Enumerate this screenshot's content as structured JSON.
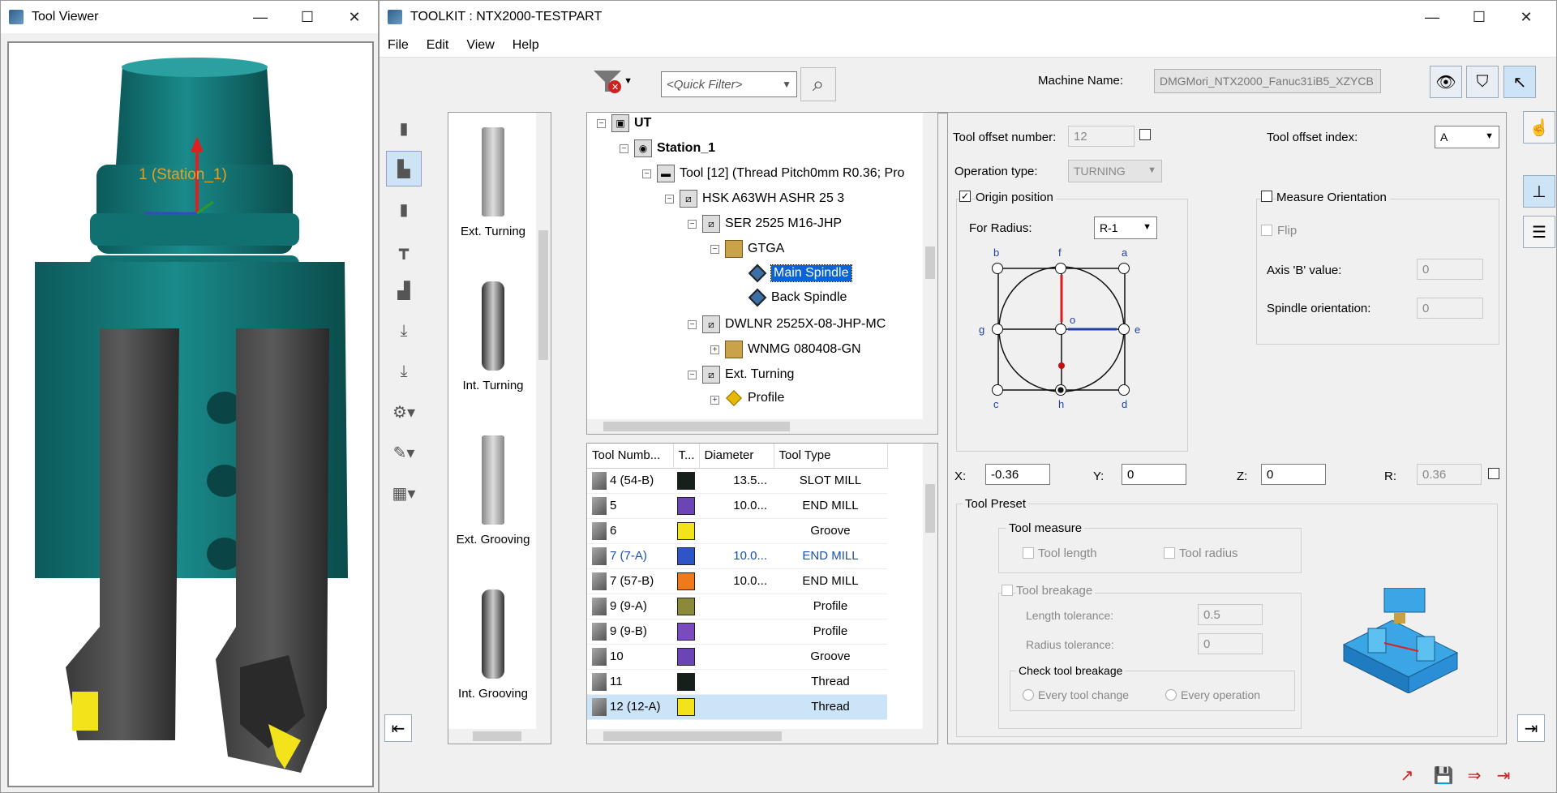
{
  "viewer": {
    "title": "Tool Viewer",
    "label3d": "1 (Station_1)"
  },
  "window": {
    "minimize": "—",
    "maximize": "☐",
    "close": "✕"
  },
  "main": {
    "title": "TOOLKIT : NTX2000-TESTPART"
  },
  "menu": [
    "File",
    "Edit",
    "View",
    "Help"
  ],
  "toolbar": {
    "quick_filter": "<Quick Filter>",
    "machine_label": "Machine Name:",
    "machine_value": "DMGMori_NTX2000_Fanuc31iB5_XZYCB"
  },
  "catalog": [
    "Ext. Turning",
    "Int. Turning",
    "Ext. Grooving",
    "Int. Grooving"
  ],
  "tree": [
    {
      "text": "UT",
      "bold": true
    },
    {
      "text": "Station_1",
      "bold": true
    },
    {
      "text": "Tool [12] (Thread Pitch0mm R0.36; Pro"
    },
    {
      "text": "HSK A63WH ASHR 25 3"
    },
    {
      "text": "SER 2525 M16-JHP"
    },
    {
      "text": "GTGA"
    },
    {
      "text": "Main Spindle"
    },
    {
      "text": "Back Spindle"
    },
    {
      "text": "DWLNR 2525X-08-JHP-MC"
    },
    {
      "text": "WNMG 080408-GN"
    },
    {
      "text": "Ext. Turning"
    },
    {
      "text": "Profile"
    }
  ],
  "grid": {
    "headers": [
      "Tool Numb...",
      "T...",
      "Diameter",
      "Tool Type"
    ],
    "rows": [
      {
        "num": "4 (54-B)",
        "color": "#15201a",
        "dia": "13.5...",
        "type": "SLOT MILL"
      },
      {
        "num": "5",
        "color": "#6b45b5",
        "dia": "10.0...",
        "type": "END MILL"
      },
      {
        "num": "6",
        "color": "#f2e31a",
        "dia": "",
        "type": "Groove"
      },
      {
        "num": "7 (7-A)",
        "color": "#2e55c8",
        "dia": "10.0...",
        "type": "END MILL",
        "blue": true
      },
      {
        "num": "7 (57-B)",
        "color": "#f07a1a",
        "dia": "10.0...",
        "type": "END MILL"
      },
      {
        "num": "9 (9-A)",
        "color": "#8a8a3a",
        "dia": "",
        "type": "Profile"
      },
      {
        "num": "9 (9-B)",
        "color": "#7a4abf",
        "dia": "",
        "type": "Profile"
      },
      {
        "num": "10",
        "color": "#6b45b5",
        "dia": "",
        "type": "Groove"
      },
      {
        "num": "11",
        "color": "#15201a",
        "dia": "",
        "type": "Thread"
      },
      {
        "num": "12 (12-A)",
        "color": "#f2e31a",
        "dia": "",
        "type": "Thread",
        "sel": true
      }
    ]
  },
  "props": {
    "offset_number_label": "Tool offset number:",
    "offset_number": "12",
    "offset_index_label": "Tool offset index:",
    "offset_index": "A",
    "op_type_label": "Operation type:",
    "op_type": "TURNING",
    "origin_position": "Origin position",
    "measure_orientation": "Measure Orientation",
    "for_radius_label": "For Radius:",
    "for_radius": "R-1",
    "flip": "Flip",
    "axis_b_label": "Axis 'B' value:",
    "axis_b": "0",
    "spindle_orient_label": "Spindle orientation:",
    "spindle_orient": "0",
    "points": {
      "a": "a",
      "b": "b",
      "c": "c",
      "d": "d",
      "e": "e",
      "f": "f",
      "g": "g",
      "h": "h",
      "o": "o"
    },
    "x_label": "X:",
    "x": "-0.36",
    "y_label": "Y:",
    "y": "0",
    "z_label": "Z:",
    "z": "0",
    "r_label": "R:",
    "r": "0.36",
    "tool_preset": "Tool Preset",
    "tool_measure": "Tool measure",
    "tool_length": "Tool length",
    "tool_radius": "Tool radius",
    "tool_breakage": "Tool breakage",
    "length_tol_label": "Length tolerance:",
    "length_tol": "0.5",
    "radius_tol_label": "Radius tolerance:",
    "radius_tol": "0",
    "check_breakage": "Check tool breakage",
    "every_tool_change": "Every tool change",
    "every_operation": "Every operation"
  }
}
